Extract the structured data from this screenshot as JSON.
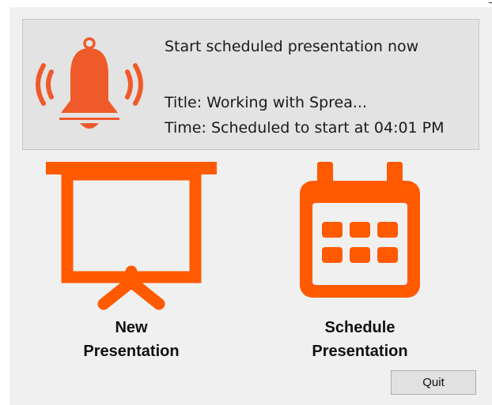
{
  "notification": {
    "heading": "Start scheduled presentation now",
    "title_line": "Title: Working with Sprea...",
    "time_line": "Time: Scheduled to start at 04:01 PM",
    "icon": "bell-ringing-icon"
  },
  "actions": {
    "new_presentation": {
      "line1": "New",
      "line2": "Presentation",
      "icon": "projector-screen-icon"
    },
    "schedule_presentation": {
      "line1": "Schedule",
      "line2": "Presentation",
      "icon": "calendar-icon"
    }
  },
  "footer": {
    "quit_label": "Quit"
  },
  "colors": {
    "accent": "#ff5a00",
    "bell": "#ef5a2a",
    "notification_bg": "#e3e3e3",
    "window_bg": "#f0f0f0"
  }
}
